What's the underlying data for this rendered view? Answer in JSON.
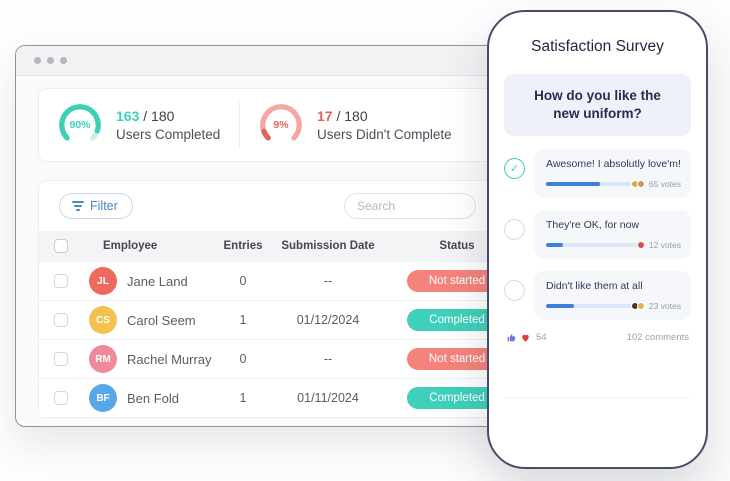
{
  "window": {
    "stats": {
      "completed": {
        "percent": 90,
        "percent_label": "90%",
        "value": "163",
        "total": " / 180",
        "label": "Users Completed",
        "color": "#3ecfb9",
        "track": "#c9efe8"
      },
      "not_completed": {
        "percent": 9,
        "percent_label": "9%",
        "value": "17",
        "total": " / 180",
        "label": "Users Didn't Complete",
        "color": "#e2635c",
        "track": "#f3a8a3"
      }
    },
    "toolbar": {
      "filter_label": "Filter",
      "search_placeholder": "Search"
    },
    "table": {
      "headers": {
        "employee": "Employee",
        "entries": "Entries",
        "date": "Submission Date",
        "status": "Status"
      },
      "rows": [
        {
          "name": "Jane Land",
          "initials": "JL",
          "avatar_color": "#ee6a5f",
          "entries": "0",
          "date": "--",
          "status": "Not started",
          "status_color": "#f5837b"
        },
        {
          "name": "Carol Seem",
          "initials": "CS",
          "avatar_color": "#f2c14e",
          "entries": "1",
          "date": "01/12/2024",
          "status": "Completed",
          "status_color": "#3ed0ba"
        },
        {
          "name": "Rachel Murray",
          "initials": "RM",
          "avatar_color": "#f08a9b",
          "entries": "0",
          "date": "--",
          "status": "Not started",
          "status_color": "#f5837b"
        },
        {
          "name": "Ben Fold",
          "initials": "BF",
          "avatar_color": "#58a8e8",
          "entries": "1",
          "date": "01/11/2024",
          "status": "Completed",
          "status_color": "#3ed0ba"
        }
      ]
    }
  },
  "phone": {
    "title": "Satisfaction Survey",
    "question": "How do you like the new uniform?",
    "options": [
      {
        "label": "Awesome! I absolutly love'm!",
        "votes": "65 votes",
        "fill_pct": 62,
        "check": "✓",
        "reactions": [
          "#e9a93d",
          "#c9985e"
        ]
      },
      {
        "label": "They're OK, for now",
        "votes": "12 votes",
        "fill_pct": 18,
        "check": "",
        "reactions": [
          "#d94f46"
        ]
      },
      {
        "label": "Didn't like them at all",
        "votes": "23 votes",
        "fill_pct": 32,
        "check": "",
        "reactions": [
          "#4a3627",
          "#e3b54c"
        ]
      }
    ],
    "likes": "54",
    "comments": "102 comments",
    "like_color": "#6a74d8",
    "heart_color": "#e23a44"
  }
}
